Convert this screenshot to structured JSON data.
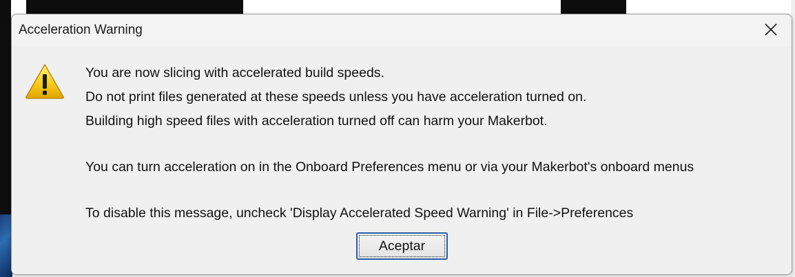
{
  "dialog": {
    "title": "Acceleration Warning",
    "close_icon": "close-icon",
    "warning_icon": "warning-triangle-icon",
    "message_lines": [
      "You are now slicing with accelerated build speeds.",
      "Do not print files generated at these speeds unless you have acceleration turned on.",
      "Building high speed files with acceleration turned off can harm your Makerbot."
    ],
    "message_onboard": "You can turn acceleration on in the Onboard Preferences menu or via your Makerbot's onboard menus",
    "message_disable": "To disable this message, uncheck 'Display Accelerated Speed Warning' in  File->Preferences",
    "ok_label": "Aceptar"
  },
  "colors": {
    "dialog_bg": "#f0f0f0",
    "button_focus_border": "#2b5fa5",
    "warning_yellow": "#f5c400"
  }
}
